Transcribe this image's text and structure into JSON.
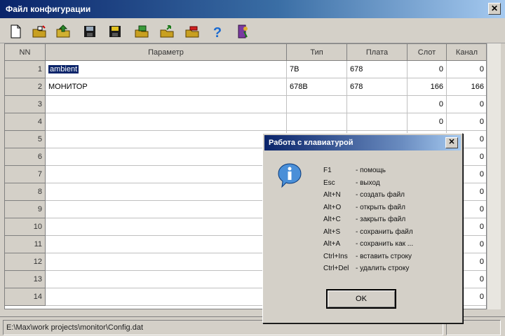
{
  "window": {
    "title": "Файл конфигурации",
    "close_glyph": "✕"
  },
  "toolbar": {
    "buttons": [
      {
        "icon": "new-file-icon"
      },
      {
        "icon": "open-file-icon"
      },
      {
        "icon": "open-folder-icon"
      },
      {
        "icon": "save-icon"
      },
      {
        "icon": "save-as-icon"
      },
      {
        "icon": "insert-row-icon"
      },
      {
        "icon": "export-icon"
      },
      {
        "icon": "delete-row-icon"
      },
      {
        "icon": "help-icon"
      },
      {
        "icon": "exit-icon"
      }
    ]
  },
  "grid": {
    "columns": [
      "NN",
      "Параметр",
      "Тип",
      "Плата",
      "Слот",
      "Канал"
    ],
    "rows": [
      {
        "num": "1",
        "param": "ambient",
        "type": "7B",
        "board": "678",
        "slot": "0",
        "channel": "0"
      },
      {
        "num": "2",
        "param": "МОНИТОР",
        "type": "678B",
        "board": "678",
        "slot": "166",
        "channel": "166"
      },
      {
        "num": "3",
        "param": "",
        "type": "",
        "board": "",
        "slot": "0",
        "channel": "0"
      },
      {
        "num": "4",
        "param": "",
        "type": "",
        "board": "",
        "slot": "0",
        "channel": "0"
      },
      {
        "num": "5",
        "param": "",
        "type": "",
        "board": "",
        "slot": "",
        "channel": "0"
      },
      {
        "num": "6",
        "param": "",
        "type": "",
        "board": "",
        "slot": "",
        "channel": "0"
      },
      {
        "num": "7",
        "param": "",
        "type": "",
        "board": "",
        "slot": "",
        "channel": "0"
      },
      {
        "num": "8",
        "param": "",
        "type": "",
        "board": "",
        "slot": "",
        "channel": "0"
      },
      {
        "num": "9",
        "param": "",
        "type": "",
        "board": "",
        "slot": "",
        "channel": "0"
      },
      {
        "num": "10",
        "param": "",
        "type": "",
        "board": "",
        "slot": "",
        "channel": "0"
      },
      {
        "num": "11",
        "param": "",
        "type": "",
        "board": "",
        "slot": "",
        "channel": "0"
      },
      {
        "num": "12",
        "param": "",
        "type": "",
        "board": "",
        "slot": "",
        "channel": "0"
      },
      {
        "num": "13",
        "param": "",
        "type": "",
        "board": "",
        "slot": "",
        "channel": "0"
      },
      {
        "num": "14",
        "param": "",
        "type": "",
        "board": "",
        "slot": "",
        "channel": "0"
      }
    ]
  },
  "status": {
    "path": "E:\\Max\\work projects\\monitor\\Config.dat"
  },
  "dialog": {
    "title": "Работа с клавиатурой",
    "close_glyph": "✕",
    "icon": "info-icon",
    "lines": [
      {
        "key": "F1",
        "desc": "- помощь"
      },
      {
        "key": "Esc",
        "desc": "- выход"
      },
      {
        "key": "Alt+N",
        "desc": "- создать файл"
      },
      {
        "key": "Alt+O",
        "desc": "- открыть файл"
      },
      {
        "key": "Alt+C",
        "desc": "- закрыть файл"
      },
      {
        "key": "Alt+S",
        "desc": "- сохранить файл"
      },
      {
        "key": "Alt+A",
        "desc": "- сохранить как ..."
      },
      {
        "key": "Ctrl+Ins",
        "desc": "- вставить строку"
      },
      {
        "key": "Ctrl+Del",
        "desc": "- удалить строку"
      }
    ],
    "ok_label": "OK"
  }
}
